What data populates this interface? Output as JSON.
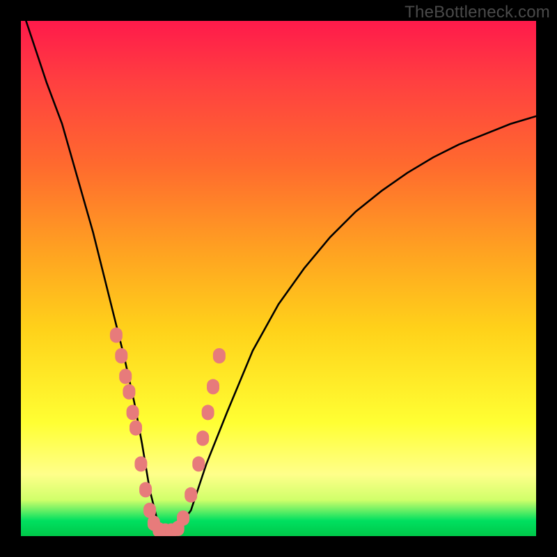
{
  "watermark": "TheBottleneck.com",
  "chart_data": {
    "type": "line",
    "title": "",
    "xlabel": "",
    "ylabel": "",
    "xlim": [
      0,
      100
    ],
    "ylim": [
      0,
      100
    ],
    "grid": false,
    "legend": false,
    "background_gradient": {
      "orientation": "vertical",
      "stops": [
        {
          "pct": 0,
          "meaning": "severe bottleneck",
          "color": "#ff1a4b"
        },
        {
          "pct": 50,
          "meaning": "moderate",
          "color": "#ffc020"
        },
        {
          "pct": 80,
          "meaning": "mild",
          "color": "#ffff50"
        },
        {
          "pct": 100,
          "meaning": "no bottleneck",
          "color": "#00c84a"
        }
      ]
    },
    "series": [
      {
        "name": "bottleneck-curve",
        "color": "#000000",
        "x": [
          1,
          3,
          5,
          8,
          10,
          12,
          14,
          16,
          18,
          20,
          22,
          23.5,
          25,
          26.5,
          28,
          30,
          33,
          36,
          40,
          45,
          50,
          55,
          60,
          65,
          70,
          75,
          80,
          85,
          90,
          95,
          100
        ],
        "y": [
          100,
          94,
          88,
          80,
          73,
          66,
          59,
          51,
          43,
          35,
          26,
          18,
          9,
          3,
          1,
          1,
          5,
          14,
          24,
          36,
          45,
          52,
          58,
          63,
          67,
          70.5,
          73.5,
          76,
          78,
          80,
          81.5
        ]
      }
    ],
    "markers": {
      "name": "sample-points",
      "color": "#e77b7b",
      "shape": "rounded",
      "points": [
        {
          "x": 18.5,
          "y": 39
        },
        {
          "x": 19.5,
          "y": 35
        },
        {
          "x": 20.3,
          "y": 31
        },
        {
          "x": 21.0,
          "y": 28
        },
        {
          "x": 21.7,
          "y": 24
        },
        {
          "x": 22.3,
          "y": 21
        },
        {
          "x": 23.3,
          "y": 14
        },
        {
          "x": 24.2,
          "y": 9
        },
        {
          "x": 25.0,
          "y": 5
        },
        {
          "x": 25.8,
          "y": 2.5
        },
        {
          "x": 26.8,
          "y": 1.2
        },
        {
          "x": 28.0,
          "y": 1
        },
        {
          "x": 29.2,
          "y": 1
        },
        {
          "x": 30.5,
          "y": 1.5
        },
        {
          "x": 31.5,
          "y": 3.5
        },
        {
          "x": 33.0,
          "y": 8
        },
        {
          "x": 34.5,
          "y": 14
        },
        {
          "x": 35.3,
          "y": 19
        },
        {
          "x": 36.3,
          "y": 24
        },
        {
          "x": 37.3,
          "y": 29
        },
        {
          "x": 38.5,
          "y": 35
        }
      ]
    }
  }
}
